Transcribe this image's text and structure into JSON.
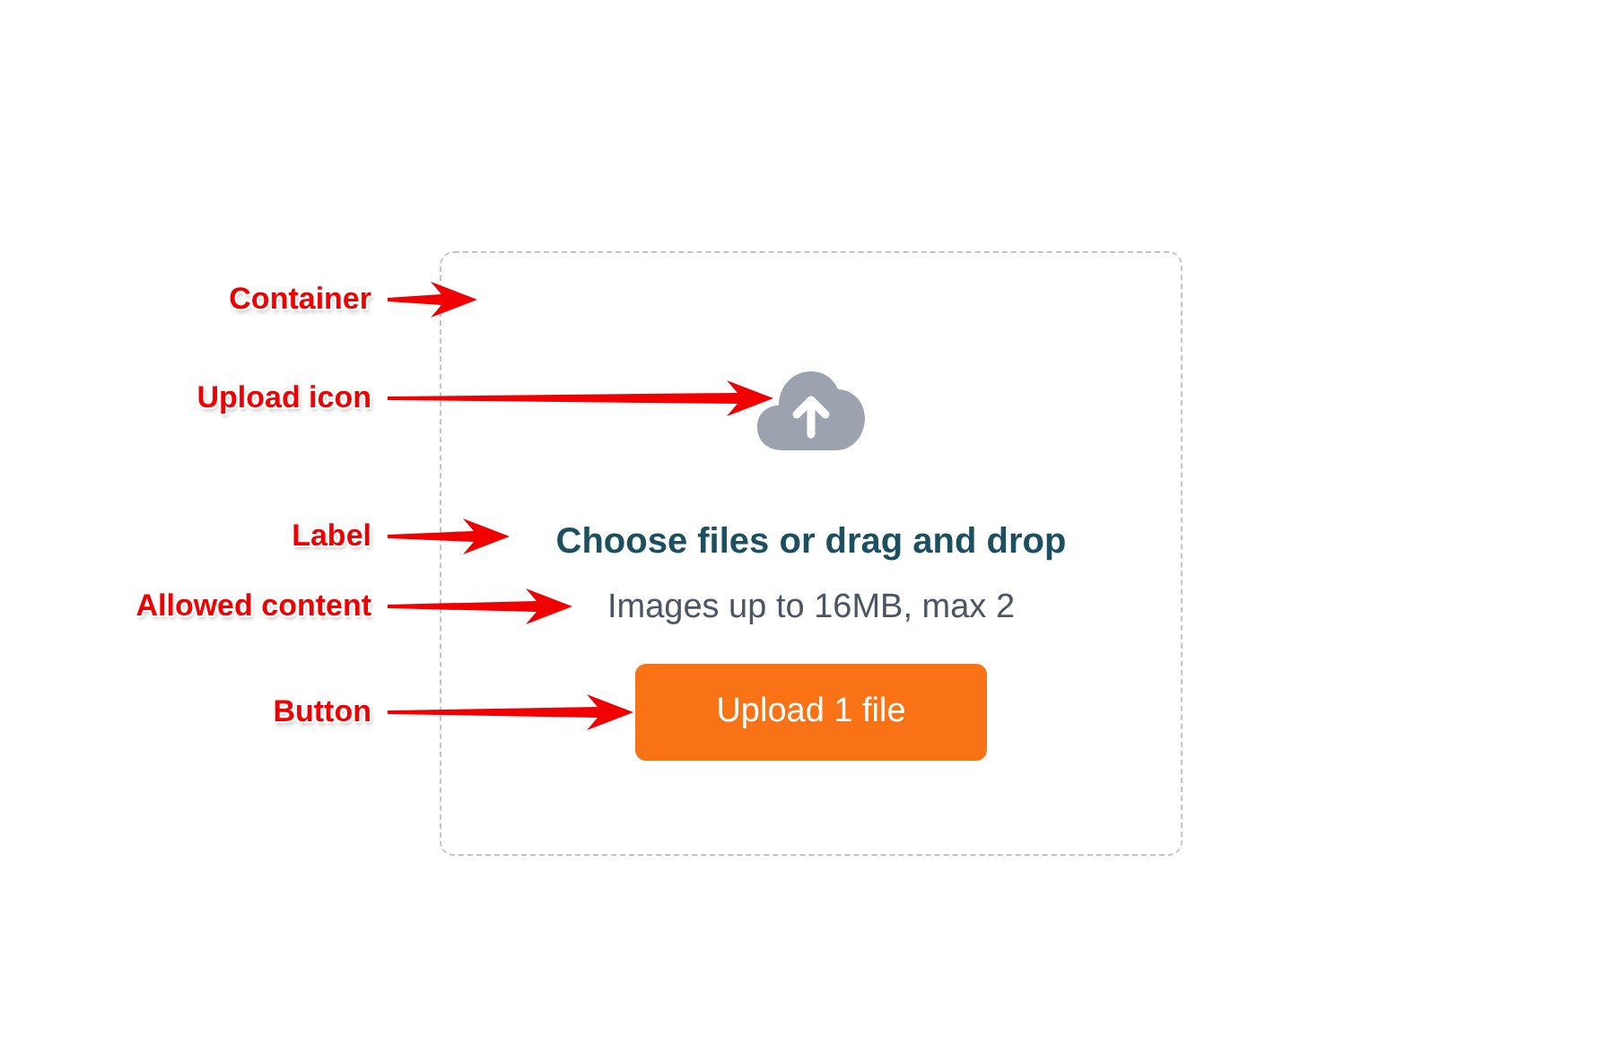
{
  "annotations": [
    {
      "label": "Container"
    },
    {
      "label": "Upload icon"
    },
    {
      "label": "Label"
    },
    {
      "label": "Allowed content"
    },
    {
      "label": "Button"
    }
  ],
  "dropzone": {
    "label": "Choose files or drag and drop",
    "allowed_content": "Images up to 16MB, max 2",
    "button": "Upload 1 file"
  }
}
